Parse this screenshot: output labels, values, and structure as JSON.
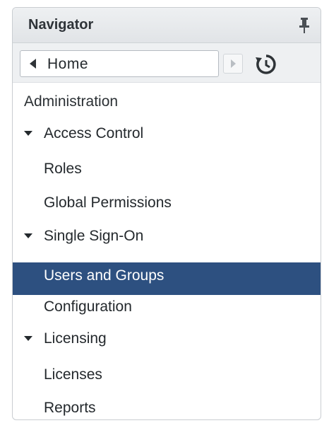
{
  "navigator": {
    "title": "Navigator"
  },
  "toolbar": {
    "home_label": "Home"
  },
  "tree": {
    "section": "Administration",
    "items": [
      {
        "label": "Access Control",
        "kind": "group",
        "expanded": true
      },
      {
        "label": "Roles",
        "kind": "leaf"
      },
      {
        "label": "Global Permissions",
        "kind": "leaf"
      },
      {
        "label": "Single Sign-On",
        "kind": "group",
        "expanded": true
      },
      {
        "label": "Users and Groups",
        "kind": "leaf",
        "selected": true
      },
      {
        "label": "Configuration",
        "kind": "leaf"
      },
      {
        "label": "Licensing",
        "kind": "group",
        "expanded": true
      },
      {
        "label": "Licenses",
        "kind": "leaf"
      },
      {
        "label": "Reports",
        "kind": "leaf"
      }
    ]
  },
  "icons": {
    "pin": "pin-icon",
    "back": "back-arrow-icon",
    "forward": "forward-arrow-icon",
    "history": "history-icon",
    "expand": "caret-down-icon"
  },
  "colors": {
    "selected_bg": "#2d5080",
    "selected_text": "#ffffff",
    "header_bg": "#e6e9ec",
    "text": "#24292d"
  }
}
